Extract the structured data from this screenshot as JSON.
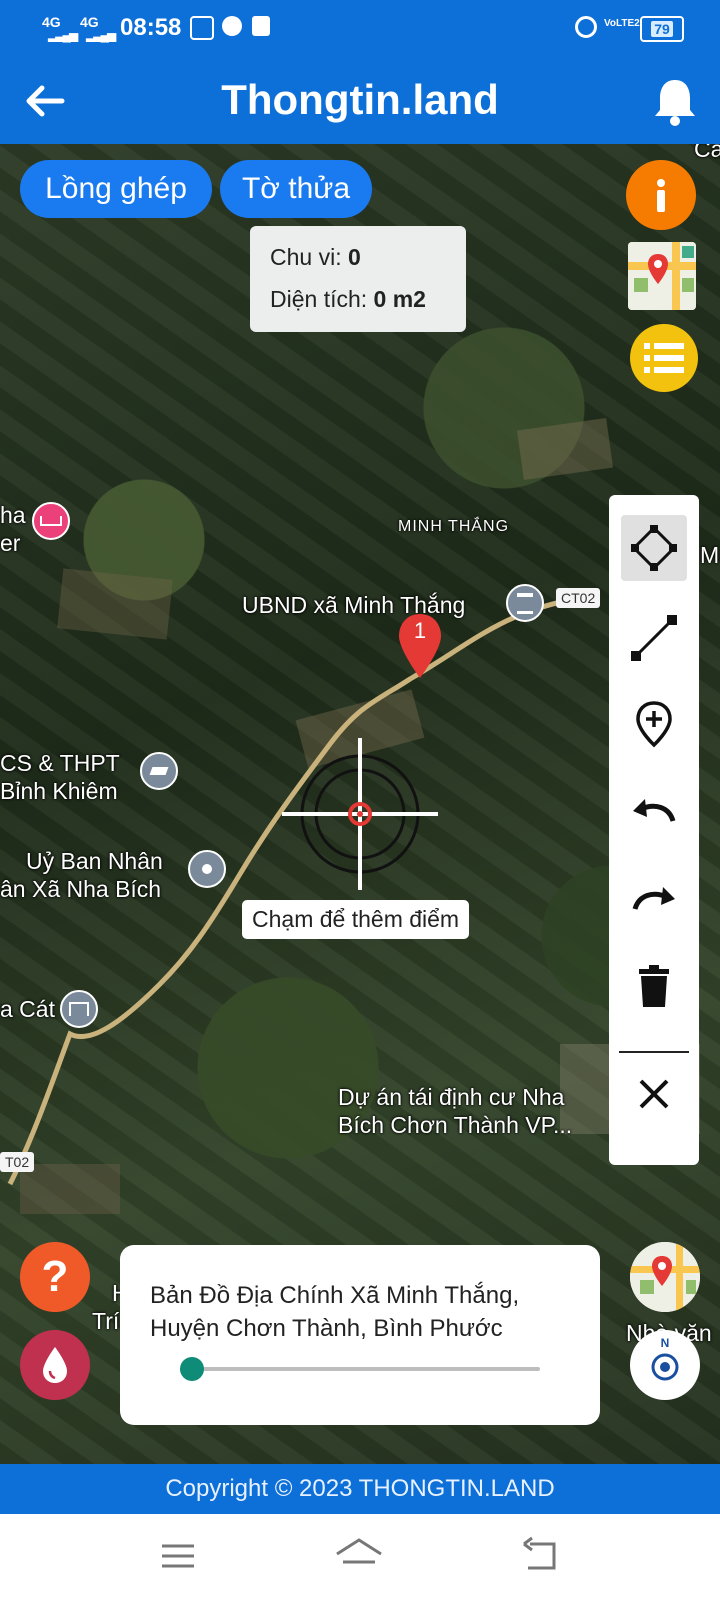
{
  "status_bar": {
    "signal1": "4G",
    "signal2": "4G",
    "time": "08:58",
    "volte": "VoLTE2",
    "battery": "79"
  },
  "app_bar": {
    "title": "Thongtin.land"
  },
  "map_controls": {
    "btn_overlay": "Lồng ghép",
    "btn_parcel": "Tờ thửa"
  },
  "measure": {
    "perimeter_label": "Chu vi: ",
    "perimeter_value": "0",
    "area_label": "Diện tích: ",
    "area_value": "0 m2"
  },
  "map_labels": {
    "minh_thang": "MINH THẮNG",
    "ubnd": "UBND xã Minh Thắng",
    "road_ct02_top": "CT02",
    "road_ct02_left": "T02",
    "school_line1": "CS & THPT",
    "school_line2": "Bỉnh Khiêm",
    "uyban_line1": "Uỷ Ban Nhân",
    "uyban_line2": "ân Xã Nha Bích",
    "cat": "a Cát",
    "hotel_line1": "ha",
    "hotel_line2": "er",
    "project_line1": "Dự án tái định cư Nha",
    "project_line2": "Bích Chơn Thành VP...",
    "edge_top_right": "Ca",
    "edge_right": "M",
    "ho_line1": "Hồ",
    "ho_line2": "Trí P",
    "nha_van": "Nhà văn",
    "marker_number": "1"
  },
  "crosshair": {
    "hint": "Chạm để thêm điểm"
  },
  "bottom_card": {
    "title": "Bản Đồ Địa Chính Xã Minh Thắng, Huyện Chơn Thành, Bình Phước",
    "opacity_fraction": 0.0
  },
  "compass": {
    "label": "N"
  },
  "footer": {
    "copyright": "Copyright © 2023 THONGTIN.LAND"
  },
  "colors": {
    "primary_blue": "#0d6fd8",
    "pill_blue": "#1a7bf0",
    "info_orange": "#f57c00",
    "list_yellow": "#f2c20f",
    "help_orange": "#f05a28",
    "drop_red": "#c0304f",
    "marker_red": "#e53935",
    "slider_teal": "#0e8c77"
  }
}
